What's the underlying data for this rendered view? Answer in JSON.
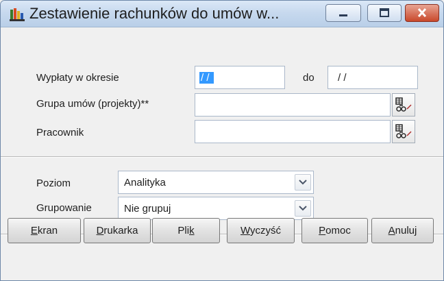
{
  "window": {
    "title": "Zestawienie rachunków do umów w...",
    "minimize_label": "Minimize",
    "maximize_label": "Maximize",
    "close_label": "Close"
  },
  "form": {
    "period_label": "Wypłaty w okresie",
    "period_from": "/ /",
    "period_to_label": "do",
    "period_to": "/ /",
    "group_label": "Grupa umów (projekty)**",
    "group_value": "",
    "employee_label": "Pracownik",
    "employee_value": "",
    "level_label": "Poziom",
    "level_value": "Analityka",
    "grouping_label": "Grupowanie",
    "grouping_value": "Nie grupuj"
  },
  "buttons": {
    "screen": {
      "underline": "E",
      "rest": "kran"
    },
    "printer": {
      "underline": "D",
      "rest": "rukarka"
    },
    "file": {
      "pre": "Pli",
      "underline": "k"
    },
    "clear": {
      "underline": "W",
      "rest": "yczyść"
    },
    "help": {
      "underline": "P",
      "rest": "omoc"
    },
    "cancel": {
      "underline": "A",
      "rest": "nuluj"
    }
  },
  "icons": {
    "app": "report-app-icon",
    "lookup": "lookup-icon",
    "dropdown": "chevron-down-icon"
  },
  "colors": {
    "selection": "#3399ff",
    "close_button": "#c9482b",
    "titlebar": "#c7d9ee"
  }
}
